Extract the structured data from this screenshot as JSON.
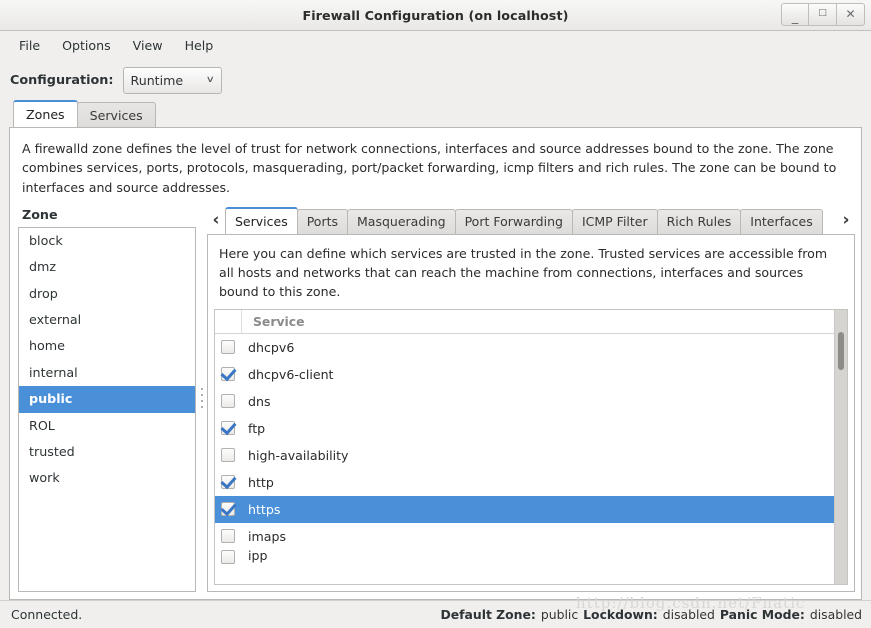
{
  "window": {
    "title": "Firewall Configuration (on localhost)",
    "buttons": [
      {
        "name": "minimize",
        "glyph": "_"
      },
      {
        "name": "maximize",
        "glyph": "□"
      },
      {
        "name": "close",
        "glyph": "✕"
      }
    ]
  },
  "menubar": {
    "items": [
      "File",
      "Options",
      "View",
      "Help"
    ]
  },
  "config": {
    "label": "Configuration:",
    "value": "Runtime",
    "arrow": "∨"
  },
  "outer_tabs": [
    {
      "label": "Zones",
      "active": true
    },
    {
      "label": "Services",
      "active": false
    }
  ],
  "zone_description": "A firewalld zone defines the level of trust for network connections, interfaces and source addresses bound to the zone. The zone combines services, ports, protocols, masquerading, port/packet forwarding, icmp filters and rich rules. The zone can be bound to interfaces and source addresses.",
  "zone_panel": {
    "header": "Zone",
    "items": [
      {
        "label": "block",
        "selected": false
      },
      {
        "label": "dmz",
        "selected": false
      },
      {
        "label": "drop",
        "selected": false
      },
      {
        "label": "external",
        "selected": false
      },
      {
        "label": "home",
        "selected": false
      },
      {
        "label": "internal",
        "selected": false
      },
      {
        "label": "public",
        "selected": true
      },
      {
        "label": "ROL",
        "selected": false
      },
      {
        "label": "trusted",
        "selected": false
      },
      {
        "label": "work",
        "selected": false
      }
    ]
  },
  "inner_tabs": {
    "prev_arrow": "‹",
    "next_arrow": "›",
    "items": [
      {
        "label": "Services",
        "active": true
      },
      {
        "label": "Ports",
        "active": false
      },
      {
        "label": "Masquerading",
        "active": false
      },
      {
        "label": "Port Forwarding",
        "active": false
      },
      {
        "label": "ICMP Filter",
        "active": false
      },
      {
        "label": "Rich Rules",
        "active": false
      },
      {
        "label": "Interfaces",
        "active": false
      }
    ]
  },
  "services_panel": {
    "description": "Here you can define which services are trusted in the zone. Trusted services are accessible from all hosts and networks that can reach the machine from connections, interfaces and sources bound to this zone.",
    "column_header": "Service",
    "rows": [
      {
        "name": "dhcpv6",
        "checked": false,
        "selected": false
      },
      {
        "name": "dhcpv6-client",
        "checked": true,
        "selected": false
      },
      {
        "name": "dns",
        "checked": false,
        "selected": false
      },
      {
        "name": "ftp",
        "checked": true,
        "selected": false
      },
      {
        "name": "high-availability",
        "checked": false,
        "selected": false
      },
      {
        "name": "http",
        "checked": true,
        "selected": false
      },
      {
        "name": "https",
        "checked": true,
        "selected": true
      },
      {
        "name": "imaps",
        "checked": false,
        "selected": false
      },
      {
        "name": "ipp",
        "checked": false,
        "selected": false
      }
    ]
  },
  "statusbar": {
    "connection": "Connected.",
    "default_zone_label": "Default Zone:",
    "default_zone_value": "public",
    "lockdown_label": "Lockdown:",
    "lockdown_value": "disabled",
    "panic_label": "Panic Mode:",
    "panic_value": "disabled"
  },
  "watermark": "http://blog.csdn.net/Fnatic",
  "colors": {
    "selection_blue": "#4a90d9",
    "window_bg": "#f0efee",
    "panel_white": "#ffffff",
    "border_gray": "#bab8b5"
  }
}
